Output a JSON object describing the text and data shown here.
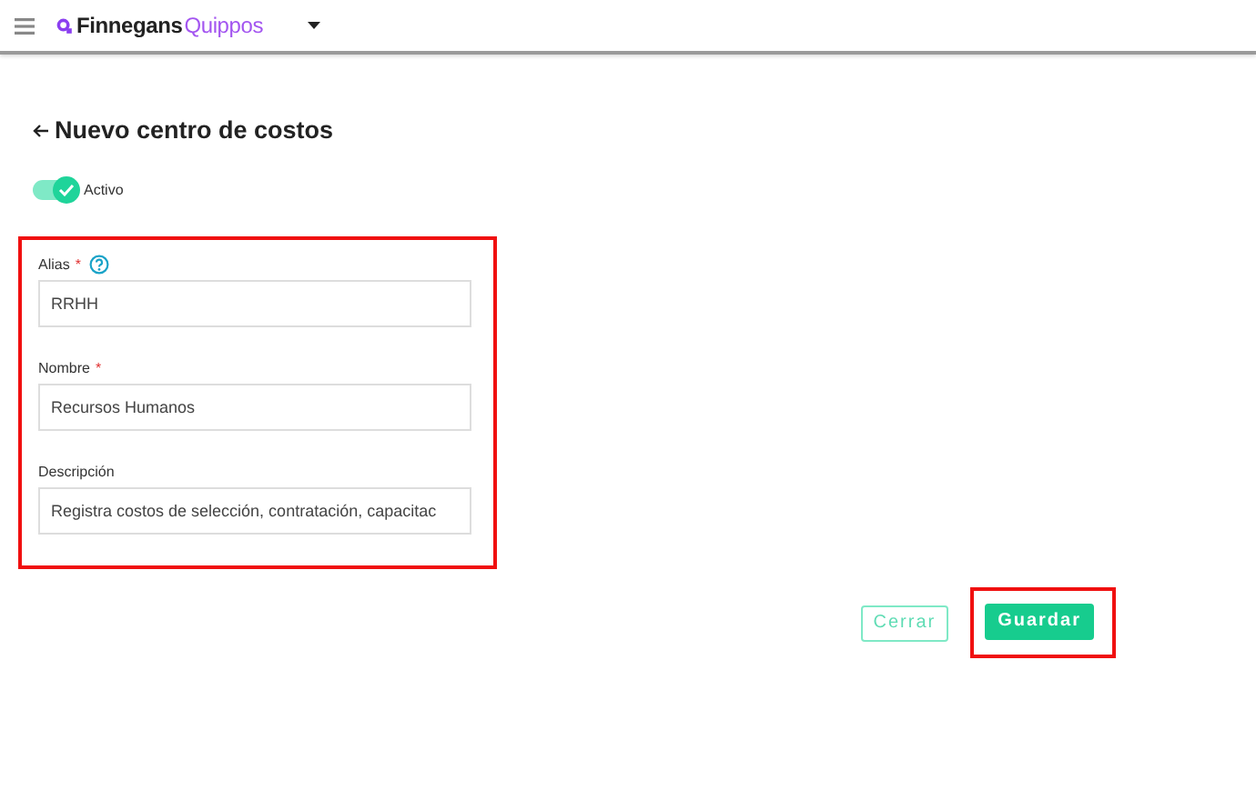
{
  "header": {
    "brand_first": "Finnegans",
    "brand_second": "Quippos"
  },
  "page": {
    "title": "Nuevo centro de costos"
  },
  "active_toggle": {
    "label": "Activo",
    "on": true
  },
  "form": {
    "highlighted": true,
    "fields": [
      {
        "label": "Alias",
        "required_mark": "*",
        "help": true,
        "value": "RRHH"
      },
      {
        "label": "Nombre",
        "required_mark": "*",
        "help": false,
        "value": "Recursos Humanos"
      },
      {
        "label": "Descripción",
        "help": false,
        "value": "Registra costos de selección, contratación, capacitac"
      }
    ]
  },
  "buttons": [
    {
      "label": "Cerrar",
      "kind": "outline",
      "highlighted": false
    },
    {
      "label": "Guardar",
      "kind": "primary",
      "highlighted": true
    }
  ]
}
